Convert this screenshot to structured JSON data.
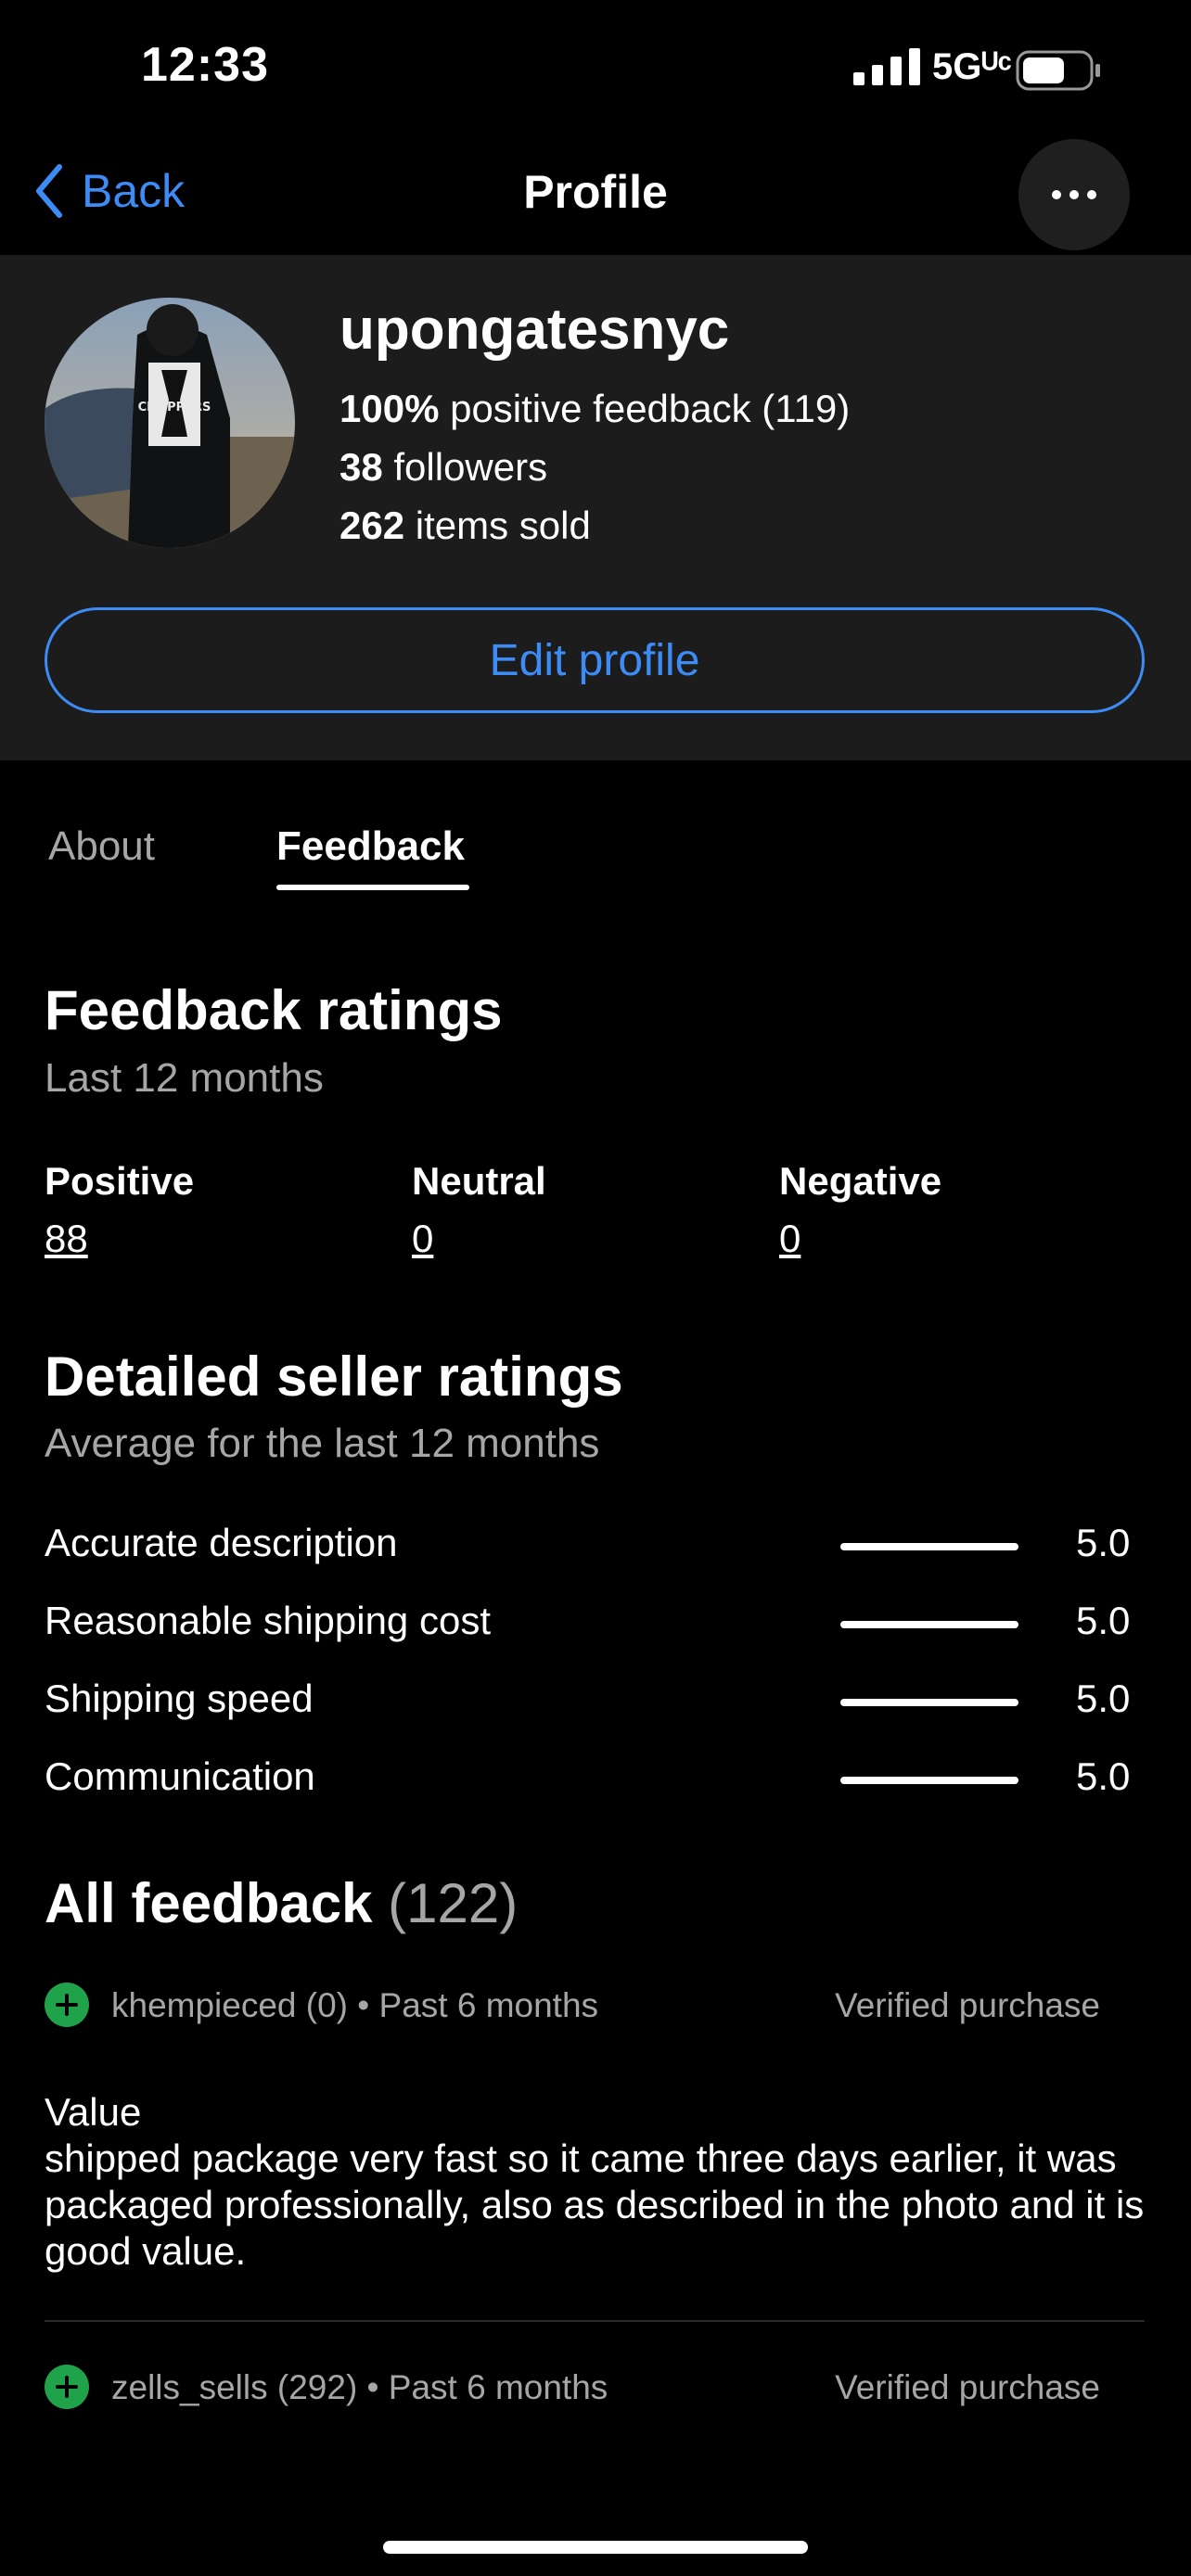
{
  "status_bar": {
    "time": "12:33",
    "network": "5Gᵁᶜ",
    "icons": [
      "signal-icon",
      "battery-icon"
    ]
  },
  "nav": {
    "back_label": "Back",
    "title": "Profile",
    "more_icon": "more-dots-icon"
  },
  "profile": {
    "username": "upongatesnyc",
    "positive_pct": "100%",
    "positive_text": " positive feedback (119)",
    "followers_count": "38",
    "followers_text": " followers",
    "items_count": "262",
    "items_text": " items sold",
    "edit_label": "Edit profile",
    "avatar_text": "CHOPPERS"
  },
  "tabs": [
    {
      "label": "About",
      "selected": false
    },
    {
      "label": "Feedback",
      "selected": true
    }
  ],
  "feedback_ratings": {
    "title": "Feedback ratings",
    "subtitle": "Last 12 months",
    "positive": {
      "label": "Positive",
      "value": "88"
    },
    "neutral": {
      "label": "Neutral",
      "value": "0"
    },
    "negative": {
      "label": "Negative",
      "value": "0"
    }
  },
  "seller_ratings": {
    "title": "Detailed seller ratings",
    "subtitle": "Average for the last 12 months",
    "rows": [
      {
        "label": "Accurate description",
        "value": "5.0"
      },
      {
        "label": "Reasonable shipping cost",
        "value": "5.0"
      },
      {
        "label": "Shipping speed",
        "value": "5.0"
      },
      {
        "label": "Communication",
        "value": "5.0"
      }
    ]
  },
  "all_feedback": {
    "title": "All feedback",
    "count": " (122)",
    "items": [
      {
        "user": "khempieced (0) • Past 6 months",
        "verified": "Verified purchase",
        "text": "Value\nshipped package very fast so it came three days earlier, it was packaged professionally, also as described in the photo and it is good value."
      },
      {
        "user": "zells_sells (292) • Past 6 months",
        "verified": "Verified purchase",
        "text": ""
      }
    ]
  },
  "colors": {
    "accent": "#3d8cf5",
    "positive": "#1fa24a",
    "header_bg": "#1c1c1c"
  }
}
